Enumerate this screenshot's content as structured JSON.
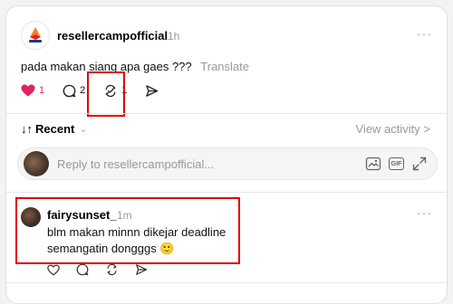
{
  "post": {
    "username": "resellercampofficial",
    "time": "1h",
    "more": "···",
    "text": "pada makan siang apa gaes ???",
    "translate": "Translate",
    "likes": "1",
    "comments": "2",
    "reposts": "1",
    "like_color": "#e0245e",
    "brand_colors": [
      "#f58220",
      "#e31e24",
      "#1b3a8c"
    ]
  },
  "sort": {
    "label": "Recent",
    "arrows": "↓↑",
    "chevron": "⌄"
  },
  "view_activity": "View activity >",
  "reply": {
    "placeholder": "Reply to resellercampofficial...",
    "gif_label": "GIF"
  },
  "comment": {
    "username": "fairysunset_",
    "time": "1m",
    "more": "···",
    "line1": "blm makan minnn dikejar deadline",
    "line2": "semangatin dongggs 🙂"
  },
  "highlight_color": "#e00000"
}
